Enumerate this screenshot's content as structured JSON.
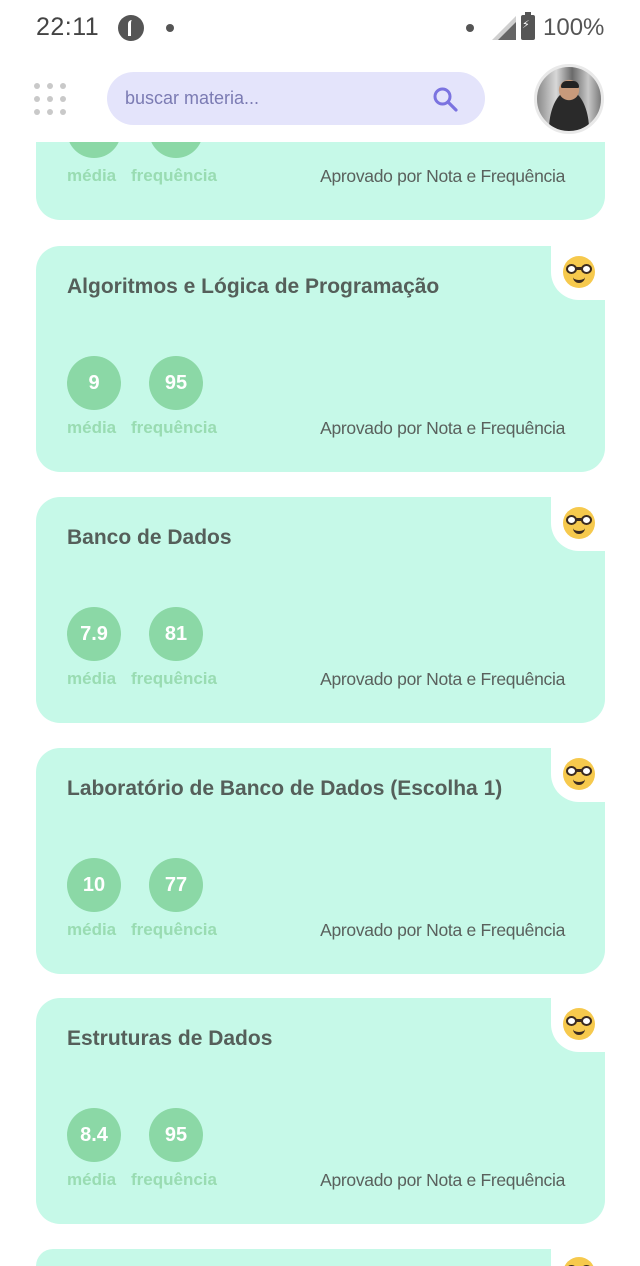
{
  "status_bar": {
    "time": "22:11",
    "battery": "100%",
    "icons": [
      "pinterest-icon",
      "notification-dot-icon",
      "signal-icon",
      "battery-charging-icon"
    ]
  },
  "header": {
    "menu_icon": "grid-dots-icon",
    "search_placeholder": "buscar materia...",
    "search_icon": "search-icon",
    "avatar": "user-avatar"
  },
  "labels": {
    "media": "média",
    "frequencia": "frequência"
  },
  "colors": {
    "card_bg": "#c6f9e8",
    "circle_bg": "#8bd8a6",
    "label": "#99dcb2",
    "search_bg": "#e4e4fb",
    "accent": "#7b73e0"
  },
  "subjects": [
    {
      "title": "",
      "media": "",
      "frequencia": "",
      "status": "Aprovado por Nota e Frequência",
      "emoji": "nerd-face-icon"
    },
    {
      "title": "Algoritmos e Lógica de Programação",
      "media": "9",
      "frequencia": "95",
      "status": "Aprovado por Nota e Frequência",
      "emoji": "nerd-face-icon"
    },
    {
      "title": "Banco de Dados",
      "media": "7.9",
      "frequencia": "81",
      "status": "Aprovado por Nota e Frequência",
      "emoji": "nerd-face-icon"
    },
    {
      "title": "Laboratório de Banco de Dados (Escolha 1)",
      "media": "10",
      "frequencia": "77",
      "status": "Aprovado por Nota e Frequência",
      "emoji": "nerd-face-icon"
    },
    {
      "title": "Estruturas de Dados",
      "media": "8.4",
      "frequencia": "95",
      "status": "Aprovado por Nota e Frequência",
      "emoji": "nerd-face-icon"
    },
    {
      "title": "",
      "media": "",
      "frequencia": "",
      "status": "",
      "emoji": "nerd-face-icon"
    }
  ]
}
